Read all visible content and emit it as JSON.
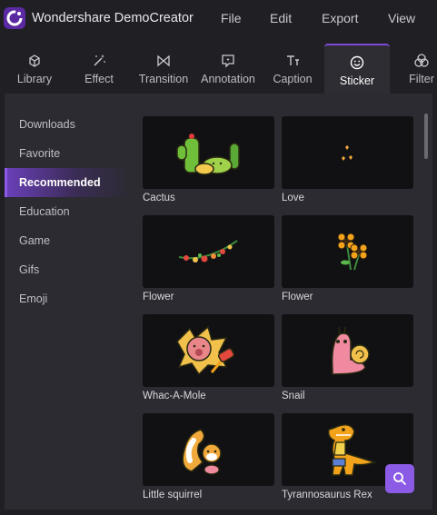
{
  "app": {
    "title": "Wondershare DemoCreator"
  },
  "menu": [
    "File",
    "Edit",
    "Export",
    "View"
  ],
  "tabs": [
    {
      "label": "Library",
      "icon": "cube-icon"
    },
    {
      "label": "Effect",
      "icon": "magic-wand-icon"
    },
    {
      "label": "Transition",
      "icon": "bowtie-icon"
    },
    {
      "label": "Annotation",
      "icon": "speech-bubble-icon"
    },
    {
      "label": "Caption",
      "icon": "text-icon"
    },
    {
      "label": "Sticker",
      "icon": "smiley-icon",
      "active": true
    },
    {
      "label": "Filter",
      "icon": "circles-icon"
    }
  ],
  "sidebar": {
    "items": [
      {
        "label": "Downloads"
      },
      {
        "label": "Favorite"
      },
      {
        "label": "Recommended",
        "active": true
      },
      {
        "label": "Education"
      },
      {
        "label": "Game"
      },
      {
        "label": "Gifs"
      },
      {
        "label": "Emoji"
      }
    ]
  },
  "stickers": [
    {
      "label": "Cactus"
    },
    {
      "label": "Love"
    },
    {
      "label": "Flower"
    },
    {
      "label": "Flower"
    },
    {
      "label": "Whac-A-Mole"
    },
    {
      "label": "Snail"
    },
    {
      "label": "Little squirrel"
    },
    {
      "label": "Tyrannosaurus Rex"
    }
  ],
  "colors": {
    "accent": "#8c5be6",
    "background": "#1f1f24",
    "panel": "#2b2b31",
    "thumb": "#111114"
  }
}
